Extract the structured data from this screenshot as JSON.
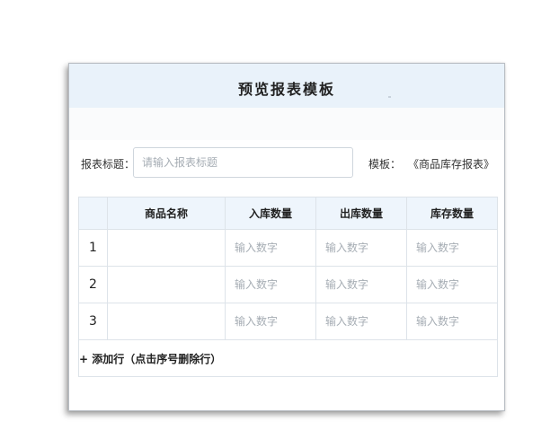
{
  "dialog": {
    "title": "预览报表模板"
  },
  "form": {
    "title_label": "报表标题：",
    "title_placeholder": "请输入报表标题",
    "template_label": "模板：",
    "template_value": "《商品库存报表》"
  },
  "table": {
    "columns": [
      "",
      "商品名称",
      "入库数量",
      "出库数量",
      "库存数量"
    ],
    "rows": [
      {
        "index": "1",
        "placeholders": [
          "输入数字",
          "输入数字",
          "输入数字"
        ]
      },
      {
        "index": "2",
        "placeholders": [
          "输入数字",
          "输入数字",
          "输入数字"
        ]
      },
      {
        "index": "3",
        "placeholders": [
          "输入数字",
          "输入数字",
          "输入数字"
        ]
      }
    ],
    "add_row_label": "+ 添加行（点击序号删除行）"
  }
}
